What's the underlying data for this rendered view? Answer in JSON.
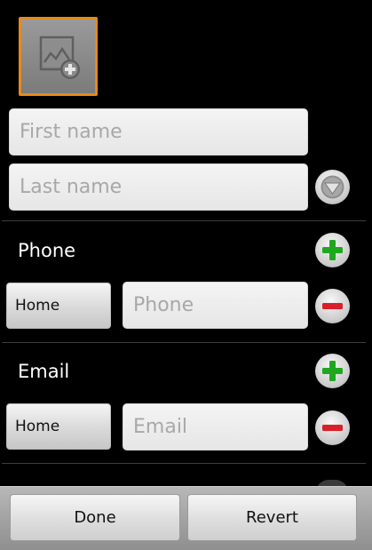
{
  "contact_editor": {
    "photo": {
      "icon": "add-photo-icon"
    },
    "name": {
      "first_placeholder": "First name",
      "last_placeholder": "Last name",
      "expand_icon": "chevron-down-icon"
    },
    "phone": {
      "section_label": "Phone",
      "type_label": "Home",
      "placeholder": "Phone",
      "add_icon": "plus-icon",
      "remove_icon": "minus-icon"
    },
    "email": {
      "section_label": "Email",
      "type_label": "Home",
      "placeholder": "Email",
      "add_icon": "plus-icon",
      "remove_icon": "minus-icon"
    }
  },
  "bottom_bar": {
    "done_label": "Done",
    "revert_label": "Revert"
  },
  "colors": {
    "photo_border": "#e88a1a",
    "add_green": "#1fa81f",
    "remove_red": "#d9202a"
  }
}
